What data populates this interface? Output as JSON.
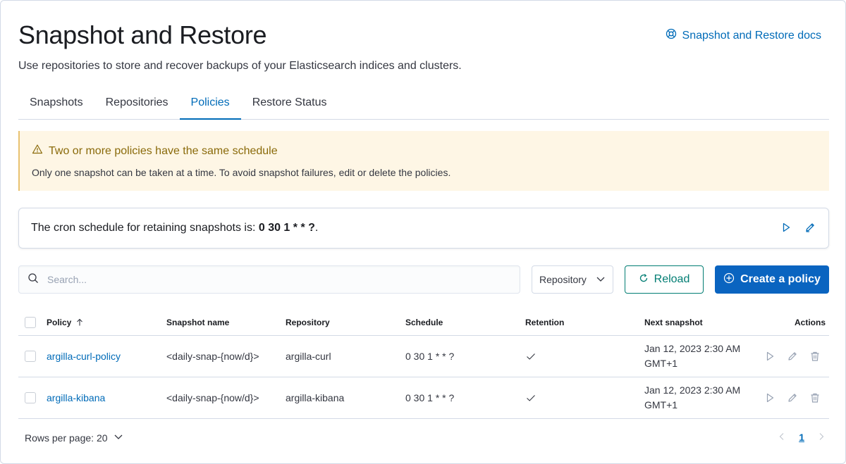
{
  "header": {
    "title": "Snapshot and Restore",
    "subtitle": "Use repositories to store and recover backups of your Elasticsearch indices and clusters.",
    "docs_link": "Snapshot and Restore docs"
  },
  "tabs": [
    {
      "label": "Snapshots",
      "active": false
    },
    {
      "label": "Repositories",
      "active": false
    },
    {
      "label": "Policies",
      "active": true
    },
    {
      "label": "Restore Status",
      "active": false
    }
  ],
  "callout": {
    "title": "Two or more policies have the same schedule",
    "body": "Only one snapshot can be taken at a time. To avoid snapshot failures, edit or delete the policies."
  },
  "cron": {
    "prefix": "The cron schedule for retaining snapshots is: ",
    "value": "0 30 1 * * ?",
    "suffix": "."
  },
  "toolbar": {
    "search_placeholder": "Search...",
    "repository_filter": "Repository",
    "reload_label": "Reload",
    "create_label": "Create a policy"
  },
  "table": {
    "columns": [
      "Policy",
      "Snapshot name",
      "Repository",
      "Schedule",
      "Retention",
      "Next snapshot",
      "Actions"
    ],
    "rows": [
      {
        "policy": "argilla-curl-policy",
        "snapshot_name": "<daily-snap-{now/d}>",
        "repository": "argilla-curl",
        "schedule": "0 30 1 * * ?",
        "retention": "check-icon",
        "next_snapshot_line1": "Jan 12, 2023 2:30 AM",
        "next_snapshot_line2": "GMT+1"
      },
      {
        "policy": "argilla-kibana",
        "snapshot_name": "<daily-snap-{now/d}>",
        "repository": "argilla-kibana",
        "schedule": "0 30 1 * * ?",
        "retention": "check-icon",
        "next_snapshot_line1": "Jan 12, 2023 2:30 AM",
        "next_snapshot_line2": "GMT+1"
      }
    ]
  },
  "pagination": {
    "rows_per_page": "Rows per page: 20",
    "current_page": "1"
  },
  "colors": {
    "link": "#006bb8",
    "primary_button": "#0a64c0",
    "reload_button": "#017d73",
    "warning_bg": "#fef6e5",
    "warning_text": "#8a6a0a"
  }
}
